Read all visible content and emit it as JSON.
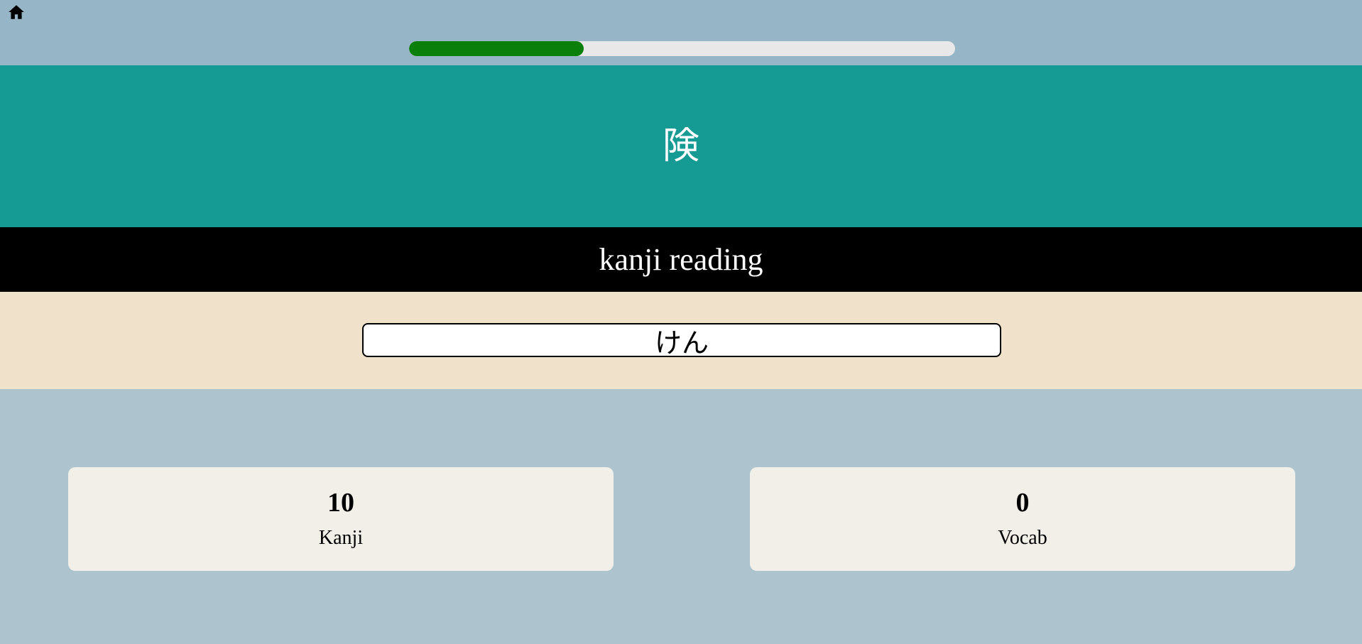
{
  "header": {
    "home_icon": "home-icon",
    "progress": 0.32,
    "progress_color": "#0a7f0a"
  },
  "prompt": {
    "character": "険",
    "background_color": "#159b94"
  },
  "question": {
    "type_label": "kanji reading"
  },
  "answer": {
    "value": "けん"
  },
  "stats": {
    "kanji": {
      "count": "10",
      "label": "Kanji"
    },
    "vocab": {
      "count": "0",
      "label": "Vocab"
    }
  }
}
